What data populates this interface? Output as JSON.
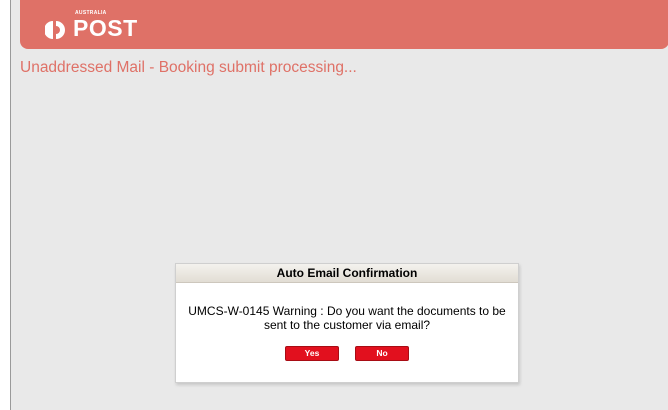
{
  "header": {
    "logo_small": "AUSTRALIA",
    "logo_big": "POST",
    "brand_color": "#df7167"
  },
  "page": {
    "title": "Unaddressed Mail - Booking submit processing..."
  },
  "dialog": {
    "title": "Auto Email Confirmation",
    "message": "UMCS-W-0145 Warning : Do you want the documents to be sent to the customer via email?",
    "yes_label": "Yes",
    "no_label": "No",
    "button_color": "#e2101e"
  },
  "icons": {
    "logo": "australia-post-logo-icon"
  }
}
